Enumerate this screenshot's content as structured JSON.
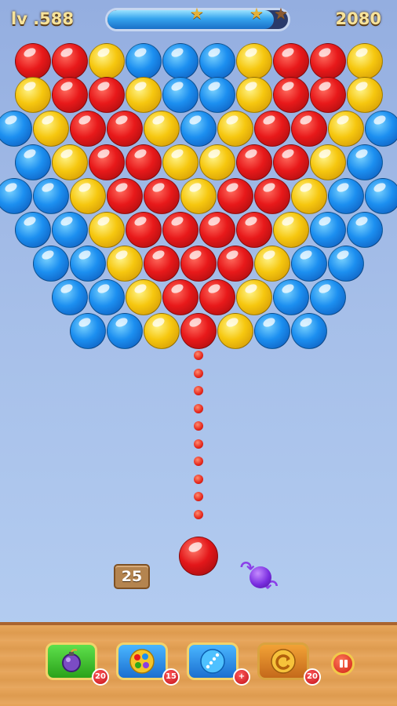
{
  "hud": {
    "level": "lv .588",
    "score": "2080",
    "progress": 0.92,
    "stars": [
      "earned-star",
      "earned-star",
      "empty-star"
    ]
  },
  "board": {
    "rows": [
      "RRYBBBYRRY",
      "YRRYBBYRRY",
      "BYRRYBYRRYB",
      "BYRRYYRRYB",
      "BBYRRYRRYBB",
      "BBYRRRRYBB",
      "BBYRRRYBB",
      "BBYRRYBB",
      "BBYRYBB"
    ]
  },
  "shooter": {
    "current_color": "red",
    "next_color": "purple",
    "shots_left": "25",
    "aim_dots": 10
  },
  "boosters": [
    {
      "name": "bomb-booster",
      "icon": "bomb-icon",
      "count": "20"
    },
    {
      "name": "color-ball-booster",
      "icon": "rainbow-ball-icon",
      "count": "15"
    },
    {
      "name": "aim-line-booster",
      "icon": "aim-line-icon",
      "count": "+"
    },
    {
      "name": "swap-booster",
      "icon": "refresh-icon",
      "count": "20"
    }
  ],
  "colors": {
    "red": "#e8191a",
    "yellow": "#f6c70f",
    "blue": "#1c8ff0",
    "purple": "#7a2ee0"
  }
}
